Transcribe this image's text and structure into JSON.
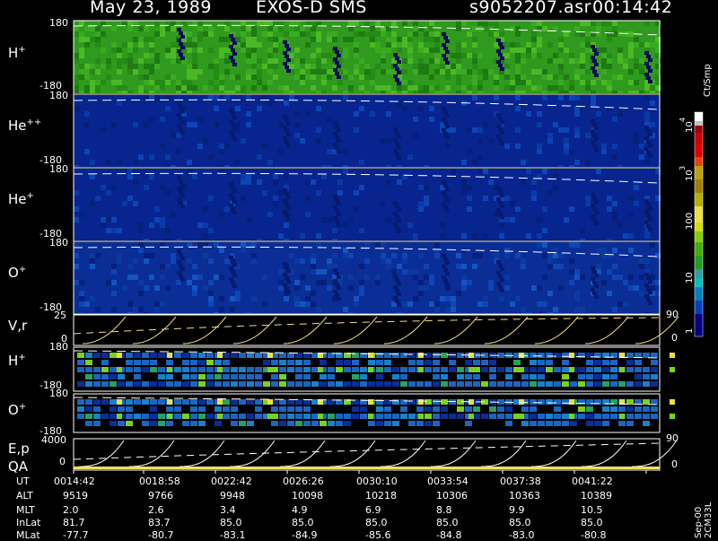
{
  "header": {
    "date": "May 23, 1989",
    "instrument": "EXOS-D SMS",
    "file": "s9052207.asr",
    "time": "00:14:42"
  },
  "colorbar": {
    "unit": "Ct/Smp",
    "tick_labels": [
      "1",
      "10",
      "100",
      "10",
      "10",
      "4",
      "3"
    ]
  },
  "panels": [
    {
      "id": "h",
      "species": "H",
      "charge": "+",
      "top": "180",
      "bottom": "-180",
      "bg": "#2f9a1d"
    },
    {
      "id": "hepp",
      "species": "He",
      "charge": "++",
      "top": "180",
      "bottom": "-180",
      "bg": "#07248f"
    },
    {
      "id": "hep",
      "species": "He",
      "charge": "+",
      "top": "180",
      "bottom": "-180",
      "bg": "#07248f"
    },
    {
      "id": "op",
      "species": "O",
      "charge": "+",
      "top": "180",
      "bottom": "-180",
      "bg": "#0a2d96"
    },
    {
      "id": "vr",
      "species": "V,r",
      "charge": "",
      "top": "25",
      "bottom": "0",
      "right_top": "90",
      "right_bottom": "0"
    },
    {
      "id": "h2",
      "species": "H",
      "charge": "+",
      "top": "180",
      "bottom": "-180"
    },
    {
      "id": "o2",
      "species": "O",
      "charge": "+",
      "top": "180",
      "bottom": "-180"
    },
    {
      "id": "ep",
      "species": "E,p",
      "extra": "QA",
      "top": "4000",
      "bottom": "0",
      "right_top": "90",
      "right_bottom": "0"
    }
  ],
  "ephemeris": {
    "labels": [
      "UT",
      "ALT",
      "MLT",
      "InLat",
      "MLat"
    ],
    "columns": [
      {
        "UT": "0014:42",
        "ALT": "9519",
        "MLT": "2.0",
        "InLat": "81.7",
        "MLat": "-77.7"
      },
      {
        "UT": "0018:58",
        "ALT": "9766",
        "MLT": "2.6",
        "InLat": "83.7",
        "MLat": "-80.7"
      },
      {
        "UT": "0022:42",
        "ALT": "9948",
        "MLT": "3.4",
        "InLat": "85.0",
        "MLat": "-83.1"
      },
      {
        "UT": "0026:26",
        "ALT": "10098",
        "MLT": "4.9",
        "InLat": "85.0",
        "MLat": "-84.9"
      },
      {
        "UT": "0030:10",
        "ALT": "10218",
        "MLT": "6.9",
        "InLat": "85.0",
        "MLat": "-85.6"
      },
      {
        "UT": "0033:54",
        "ALT": "10306",
        "MLT": "8.8",
        "InLat": "85.0",
        "MLat": "-84.8"
      },
      {
        "UT": "0037:38",
        "ALT": "10363",
        "MLT": "9.9",
        "InLat": "85.0",
        "MLat": "-83.0"
      },
      {
        "UT": "0041:22",
        "ALT": "10389",
        "MLT": "10.5",
        "InLat": "85.0",
        "MLat": "-80.8"
      }
    ]
  },
  "footer": {
    "stamp": "Sep-00 2CM33L"
  },
  "chart_data": {
    "type": "heatmap",
    "title": "May 23, 1989   EXOS-D SMS",
    "x_tick_labels": [
      "0014:42",
      "0018:58",
      "0022:42",
      "0026:26",
      "0030:10",
      "0033:54",
      "0037:38",
      "0041:22"
    ],
    "colorscale_unit": "Ct/Smp",
    "colorscale": [
      "#000080",
      "#0040c0",
      "#00c0c0",
      "#20b020",
      "#80e000",
      "#e0e000",
      "#a08000",
      "#e00000",
      "#ffffff"
    ]
  }
}
